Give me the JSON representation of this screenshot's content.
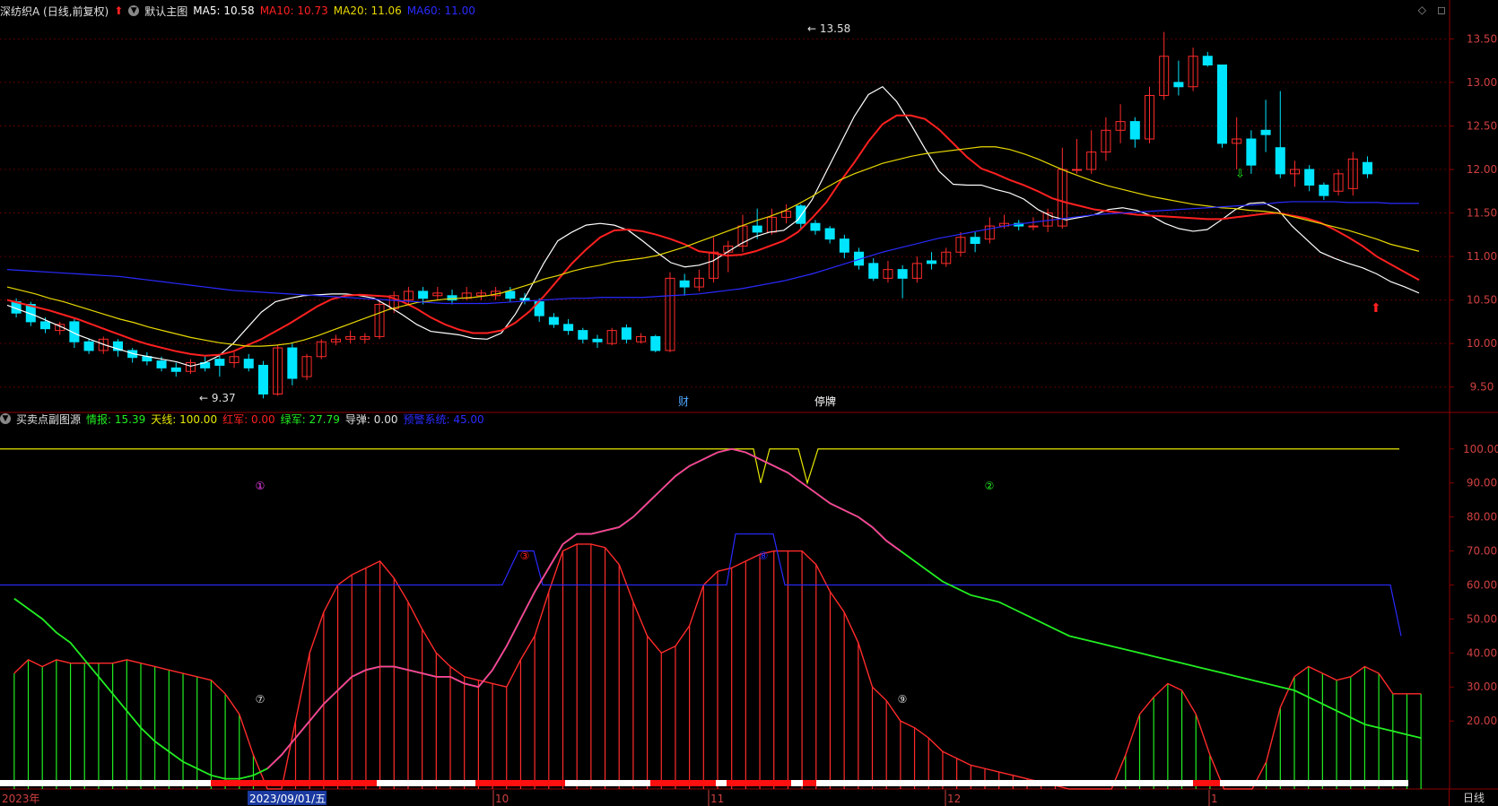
{
  "main_legend": {
    "stock": "深纺织A (日线,前复权)",
    "template": "默认主图",
    "ma5": "MA5: 10.58",
    "ma10": "MA10: 10.73",
    "ma20": "MA20: 11.06",
    "ma60": "MA60: 11.00"
  },
  "sub_legend": {
    "indicator": "买卖点副图源",
    "qingbao": "情报: 15.39",
    "tianxian": "天线: 100.00",
    "hongjun": "红军: 0.00",
    "lvjun": "绿军: 27.79",
    "daodan": "导弹: 0.00",
    "yujing": "预警系统: 45.00"
  },
  "markers": {
    "high": "13.58",
    "low": "9.37",
    "cai": "财",
    "tingpai": "停牌"
  },
  "circle_labels": [
    "①",
    "②",
    "⑦",
    "③",
    "⑧",
    "⑨"
  ],
  "date_axis": {
    "year": "2023年",
    "cursor_date": "2023/09/01/五",
    "months": [
      "10",
      "11",
      "12",
      "1"
    ]
  },
  "period_button": "日线",
  "colors": {
    "up": "#ff2b2b",
    "down": "#00e5ff",
    "ma5": "#ffffff",
    "ma10": "#ff2020",
    "ma20": "#e8d800",
    "ma60": "#2a2aff",
    "grid": "#5a0000",
    "green": "#22ee22",
    "magenta": "#ff3d9a",
    "blue": "#2a2aff",
    "yellow": "#e8e800"
  },
  "chart_data": [
    {
      "type": "candlestick",
      "y_ticks": [
        13.5,
        13.0,
        12.5,
        12.0,
        11.5,
        11.0,
        10.5,
        10.0,
        9.5
      ],
      "ylim": [
        9.25,
        13.72
      ],
      "series": [
        {
          "name": "MA5",
          "values": [
            10.44,
            10.38,
            10.32,
            10.25,
            10.18,
            10.1,
            10.04,
            9.98,
            9.93,
            9.88,
            9.85,
            9.82,
            9.79,
            9.74,
            9.78,
            9.86,
            10.0,
            10.18,
            10.36,
            10.48,
            10.52,
            10.55,
            10.56,
            10.57,
            10.57,
            10.55,
            10.52,
            10.43,
            10.33,
            10.22,
            10.14,
            10.12,
            10.1,
            10.06,
            10.05,
            10.12,
            10.34,
            10.62,
            10.92,
            11.18,
            11.28,
            11.36,
            11.38,
            11.36,
            11.3,
            11.18,
            11.05,
            10.93,
            10.88,
            10.9,
            10.95,
            11.05,
            11.15,
            11.23,
            11.28,
            11.3,
            11.42,
            11.65,
            11.97,
            12.29,
            12.61,
            12.86,
            12.95,
            12.78,
            12.52,
            12.24,
            11.98,
            11.83,
            11.82,
            11.82,
            11.77,
            11.73,
            11.66,
            11.54,
            11.46,
            11.42,
            11.45,
            11.48,
            11.54,
            11.56,
            11.53,
            11.47,
            11.38,
            11.32,
            11.29,
            11.31,
            11.42,
            11.54,
            11.61,
            11.62,
            11.54,
            11.35,
            11.2,
            11.05,
            10.98,
            10.92,
            10.87,
            10.8,
            10.71,
            10.65,
            10.58
          ]
        },
        {
          "name": "MA10",
          "values": [
            10.5,
            10.46,
            10.42,
            10.38,
            10.33,
            10.28,
            10.22,
            10.16,
            10.1,
            10.04,
            9.99,
            9.95,
            9.91,
            9.88,
            9.86,
            9.87,
            9.91,
            9.98,
            10.05,
            10.14,
            10.23,
            10.33,
            10.43,
            10.51,
            10.55,
            10.56,
            10.55,
            10.54,
            10.48,
            10.4,
            10.3,
            10.22,
            10.16,
            10.12,
            10.12,
            10.15,
            10.24,
            10.37,
            10.54,
            10.73,
            10.92,
            11.08,
            11.22,
            11.3,
            11.31,
            11.29,
            11.25,
            11.2,
            11.14,
            11.06,
            11.04,
            11.01,
            11.02,
            11.06,
            11.12,
            11.18,
            11.28,
            11.44,
            11.62,
            11.86,
            12.08,
            12.32,
            12.52,
            12.62,
            12.62,
            12.58,
            12.46,
            12.3,
            12.14,
            12.01,
            11.95,
            11.88,
            11.82,
            11.75,
            11.67,
            11.62,
            11.58,
            11.54,
            11.52,
            11.5,
            11.48,
            11.47,
            11.46,
            11.45,
            11.44,
            11.43,
            11.43,
            11.45,
            11.47,
            11.49,
            11.5,
            11.47,
            11.44,
            11.39,
            11.31,
            11.22,
            11.12,
            11.0,
            10.91,
            10.82,
            10.73
          ]
        },
        {
          "name": "MA20",
          "values": [
            10.65,
            10.61,
            10.57,
            10.52,
            10.48,
            10.43,
            10.38,
            10.33,
            10.28,
            10.24,
            10.19,
            10.15,
            10.11,
            10.07,
            10.04,
            10.01,
            9.99,
            9.97,
            9.97,
            9.98,
            10.0,
            10.04,
            10.09,
            10.15,
            10.21,
            10.27,
            10.33,
            10.39,
            10.43,
            10.47,
            10.49,
            10.51,
            10.52,
            10.53,
            10.55,
            10.58,
            10.63,
            10.68,
            10.74,
            10.78,
            10.83,
            10.87,
            10.9,
            10.94,
            10.96,
            10.98,
            11.01,
            11.06,
            11.11,
            11.17,
            11.23,
            11.29,
            11.35,
            11.41,
            11.46,
            11.52,
            11.6,
            11.69,
            11.79,
            11.88,
            11.95,
            12.01,
            12.07,
            12.11,
            12.15,
            12.18,
            12.2,
            12.22,
            12.24,
            12.26,
            12.26,
            12.23,
            12.18,
            12.12,
            12.05,
            11.98,
            11.92,
            11.86,
            11.81,
            11.77,
            11.73,
            11.69,
            11.66,
            11.63,
            11.6,
            11.58,
            11.56,
            11.55,
            11.53,
            11.52,
            11.5,
            11.46,
            11.42,
            11.38,
            11.34,
            11.3,
            11.25,
            11.2,
            11.14,
            11.1,
            11.06
          ]
        },
        {
          "name": "MA60",
          "values": [
            10.85,
            10.84,
            10.83,
            10.82,
            10.81,
            10.8,
            10.79,
            10.78,
            10.77,
            10.75,
            10.73,
            10.71,
            10.69,
            10.67,
            10.65,
            10.63,
            10.61,
            10.6,
            10.59,
            10.58,
            10.57,
            10.56,
            10.55,
            10.54,
            10.53,
            10.52,
            10.51,
            10.5,
            10.49,
            10.48,
            10.47,
            10.46,
            10.46,
            10.46,
            10.46,
            10.47,
            10.48,
            10.49,
            10.5,
            10.51,
            10.52,
            10.52,
            10.53,
            10.53,
            10.53,
            10.53,
            10.54,
            10.55,
            10.56,
            10.57,
            10.59,
            10.61,
            10.63,
            10.66,
            10.69,
            10.72,
            10.76,
            10.8,
            10.85,
            10.9,
            10.95,
            11.0,
            11.05,
            11.09,
            11.13,
            11.17,
            11.21,
            11.24,
            11.27,
            11.3,
            11.33,
            11.36,
            11.38,
            11.4,
            11.42,
            11.44,
            11.46,
            11.48,
            11.49,
            11.5,
            11.51,
            11.52,
            11.53,
            11.54,
            11.55,
            11.56,
            11.57,
            11.58,
            11.59,
            11.6,
            11.62,
            11.63,
            11.63,
            11.63,
            11.63,
            11.62,
            11.62,
            11.62,
            11.61,
            11.61,
            11.61
          ]
        }
      ],
      "candles": [
        [
          10.48,
          10.35,
          10.52,
          10.3
        ],
        [
          10.45,
          10.25,
          10.48,
          10.2
        ],
        [
          10.25,
          10.17,
          10.3,
          10.12
        ],
        [
          10.15,
          10.22,
          10.25,
          10.1
        ],
        [
          10.25,
          10.02,
          10.28,
          9.95
        ],
        [
          10.02,
          9.92,
          10.05,
          9.88
        ],
        [
          9.92,
          10.05,
          10.08,
          9.88
        ],
        [
          10.02,
          9.92,
          10.05,
          9.85
        ],
        [
          9.92,
          9.84,
          9.95,
          9.78
        ],
        [
          9.85,
          9.8,
          9.9,
          9.75
        ],
        [
          9.8,
          9.72,
          9.85,
          9.68
        ],
        [
          9.72,
          9.68,
          9.78,
          9.62
        ],
        [
          9.68,
          9.78,
          9.82,
          9.65
        ],
        [
          9.78,
          9.72,
          9.85,
          9.68
        ],
        [
          9.82,
          9.75,
          9.88,
          9.62
        ],
        [
          9.78,
          9.85,
          9.9,
          9.72
        ],
        [
          9.82,
          9.72,
          9.88,
          9.68
        ],
        [
          9.75,
          9.42,
          9.8,
          9.37
        ],
        [
          9.42,
          9.95,
          9.98,
          9.4
        ],
        [
          9.95,
          9.6,
          10.0,
          9.52
        ],
        [
          9.62,
          9.85,
          9.88,
          9.58
        ],
        [
          9.85,
          10.02,
          10.05,
          9.82
        ],
        [
          10.02,
          10.05,
          10.1,
          9.98
        ],
        [
          10.05,
          10.08,
          10.15,
          10.0
        ],
        [
          10.05,
          10.08,
          10.12,
          10.0
        ],
        [
          10.08,
          10.45,
          10.5,
          10.05
        ],
        [
          10.4,
          10.55,
          10.6,
          10.35
        ],
        [
          10.5,
          10.6,
          10.65,
          10.45
        ],
        [
          10.6,
          10.52,
          10.65,
          10.45
        ],
        [
          10.55,
          10.58,
          10.65,
          10.5
        ],
        [
          10.55,
          10.5,
          10.62,
          10.45
        ],
        [
          10.52,
          10.58,
          10.65,
          10.5
        ],
        [
          10.55,
          10.58,
          10.62,
          10.5
        ],
        [
          10.55,
          10.6,
          10.65,
          10.5
        ],
        [
          10.6,
          10.52,
          10.65,
          10.48
        ],
        [
          10.52,
          10.5,
          10.58,
          10.45
        ],
        [
          10.48,
          10.32,
          10.52,
          10.25
        ],
        [
          10.3,
          10.22,
          10.35,
          10.18
        ],
        [
          10.22,
          10.15,
          10.28,
          10.1
        ],
        [
          10.15,
          10.05,
          10.18,
          10.0
        ],
        [
          10.05,
          10.02,
          10.1,
          9.95
        ],
        [
          10.0,
          10.15,
          10.18,
          9.98
        ],
        [
          10.18,
          10.05,
          10.22,
          10.0
        ],
        [
          10.02,
          10.08,
          10.12,
          10.0
        ],
        [
          10.08,
          9.92,
          10.1,
          9.9
        ],
        [
          9.92,
          10.75,
          10.82,
          9.9
        ],
        [
          10.72,
          10.65,
          10.8,
          10.55
        ],
        [
          10.65,
          10.75,
          10.85,
          10.6
        ],
        [
          10.75,
          11.05,
          11.22,
          10.7
        ],
        [
          11.05,
          11.12,
          11.18,
          10.82
        ],
        [
          11.12,
          11.35,
          11.48,
          11.05
        ],
        [
          11.35,
          11.28,
          11.55,
          11.2
        ],
        [
          11.28,
          11.45,
          11.55,
          11.25
        ],
        [
          11.45,
          11.52,
          11.6,
          11.38
        ],
        [
          11.58,
          11.38,
          11.6,
          11.3
        ],
        [
          11.38,
          11.3,
          11.42,
          11.25
        ],
        [
          11.32,
          11.2,
          11.35,
          11.15
        ],
        [
          11.2,
          11.05,
          11.25,
          10.98
        ],
        [
          11.05,
          10.9,
          11.1,
          10.85
        ],
        [
          10.92,
          10.75,
          10.98,
          10.72
        ],
        [
          10.75,
          10.85,
          10.95,
          10.7
        ],
        [
          10.85,
          10.75,
          10.9,
          10.52
        ],
        [
          10.75,
          10.92,
          11.0,
          10.7
        ],
        [
          10.95,
          10.92,
          11.05,
          10.85
        ],
        [
          10.92,
          11.05,
          11.1,
          10.88
        ],
        [
          11.05,
          11.22,
          11.28,
          11.0
        ],
        [
          11.22,
          11.15,
          11.28,
          11.05
        ],
        [
          11.2,
          11.35,
          11.45,
          11.15
        ],
        [
          11.35,
          11.38,
          11.48,
          11.32
        ],
        [
          11.38,
          11.35,
          11.42,
          11.3
        ],
        [
          11.35,
          11.35,
          11.45,
          11.3
        ],
        [
          11.35,
          11.5,
          11.55,
          11.28
        ],
        [
          11.35,
          12.0,
          12.25,
          11.32
        ],
        [
          12.0,
          12.0,
          12.35,
          11.95
        ],
        [
          12.0,
          12.2,
          12.45,
          11.95
        ],
        [
          12.2,
          12.45,
          12.6,
          12.1
        ],
        [
          12.45,
          12.55,
          12.75,
          12.3
        ],
        [
          12.55,
          12.35,
          12.6,
          12.25
        ],
        [
          12.35,
          12.85,
          12.95,
          12.3
        ],
        [
          12.85,
          13.3,
          13.58,
          12.8
        ],
        [
          13.0,
          12.95,
          13.25,
          12.85
        ],
        [
          12.95,
          13.3,
          13.4,
          12.9
        ],
        [
          13.3,
          13.2,
          13.35,
          13.18
        ],
        [
          13.2,
          12.3,
          13.2,
          12.25
        ],
        [
          12.3,
          12.35,
          12.6,
          12.0
        ],
        [
          12.35,
          12.05,
          12.45,
          11.95
        ],
        [
          12.45,
          12.4,
          12.8,
          12.2
        ],
        [
          12.25,
          11.95,
          12.9,
          11.9
        ],
        [
          11.95,
          12.0,
          12.1,
          11.8
        ],
        [
          12.0,
          11.82,
          12.05,
          11.75
        ],
        [
          11.82,
          11.7,
          11.85,
          11.65
        ],
        [
          11.75,
          11.95,
          12.0,
          11.7
        ],
        [
          11.78,
          12.12,
          12.2,
          11.7
        ],
        [
          12.08,
          11.95,
          12.15,
          11.9
        ]
      ],
      "candles_note": "open, close, high, low per day; partial set as visible",
      "annotations": [
        "13.58",
        "9.37"
      ]
    },
    {
      "type": "histogram+line",
      "y_ticks": [
        100,
        90,
        80,
        70,
        60,
        50,
        40,
        30,
        20
      ],
      "ylim": [
        0,
        106
      ],
      "series": [
        {
          "name": "天线",
          "values": [
            100
          ]
        },
        {
          "name": "预警系统",
          "values": [
            60,
            45
          ]
        },
        {
          "name": "情报",
          "values": [
            55,
            15.39
          ]
        },
        {
          "name": "红军",
          "values": [
            0.0
          ]
        },
        {
          "name": "绿军",
          "values": [
            27.79
          ]
        }
      ]
    }
  ]
}
